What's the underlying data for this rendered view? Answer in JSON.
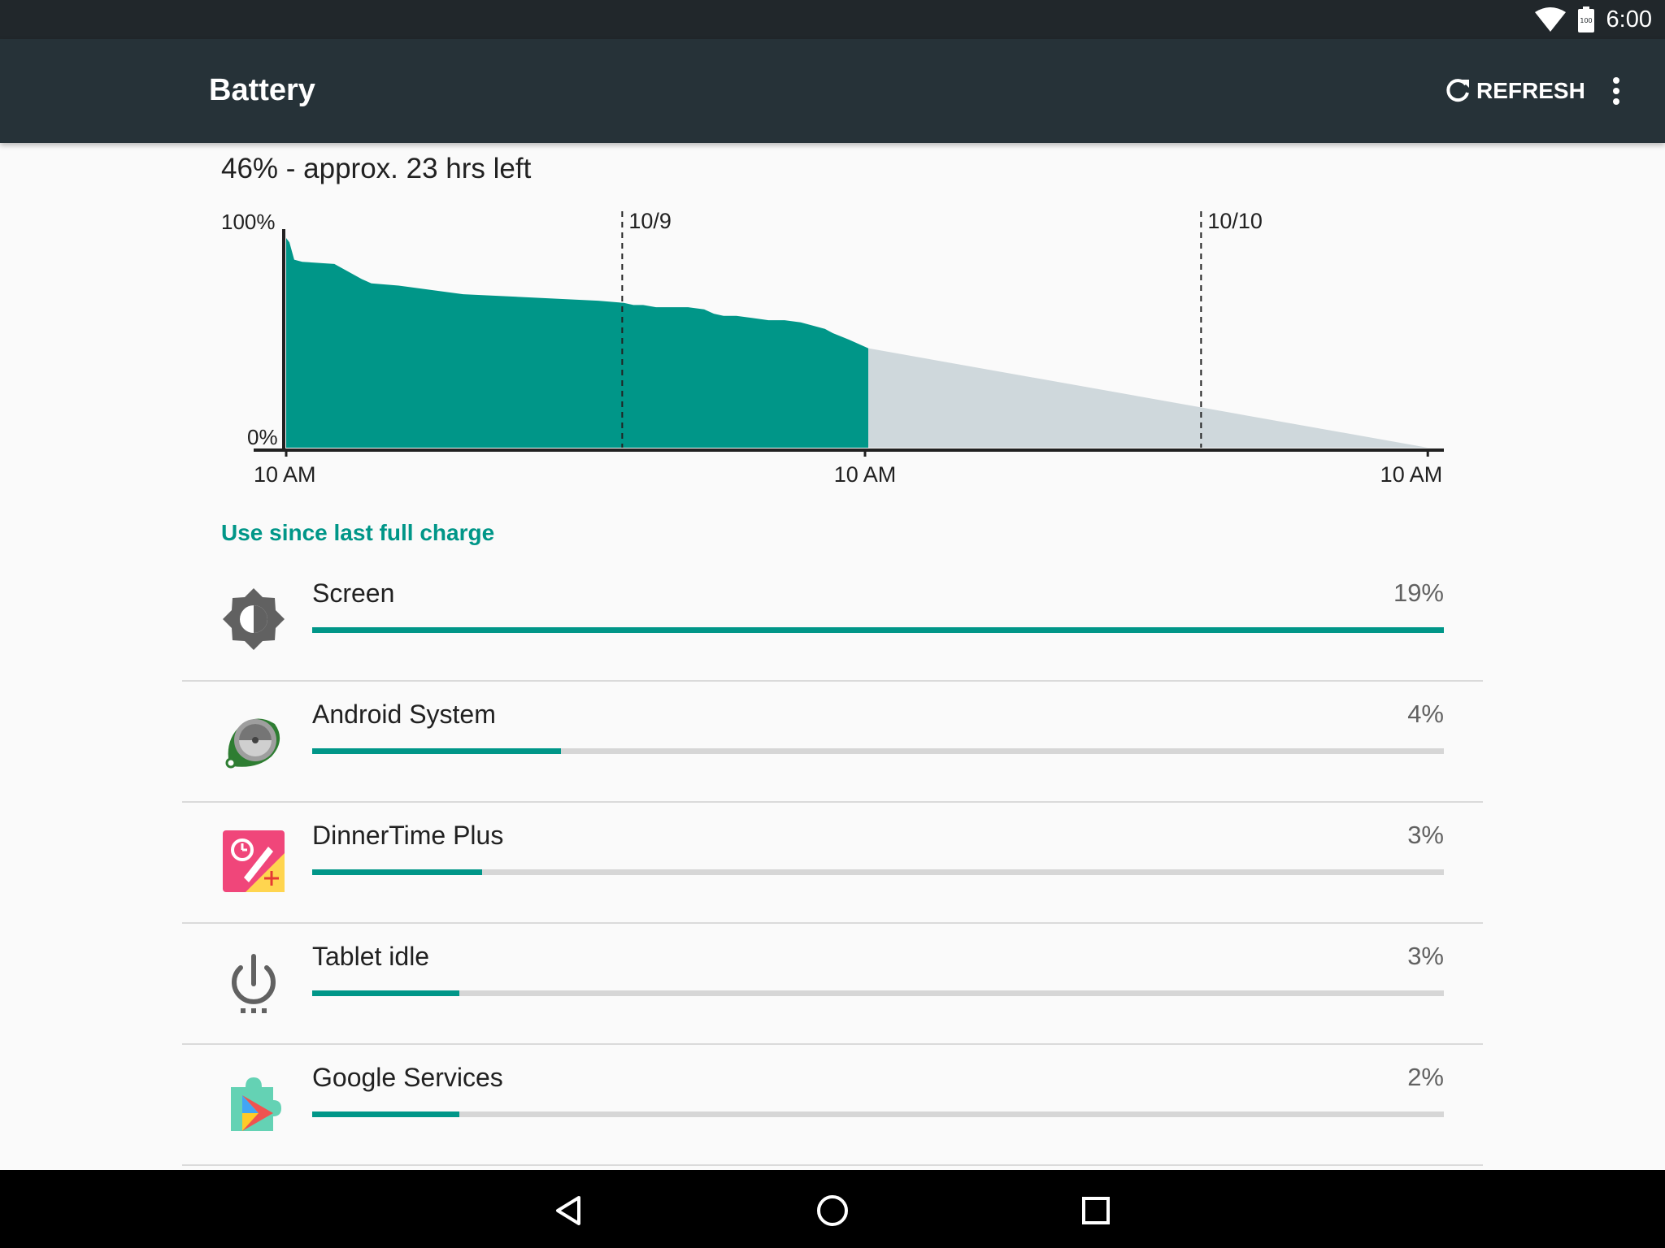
{
  "status_bar": {
    "time": "6:00",
    "battery_icon_text": "100",
    "icons": [
      "wifi-icon",
      "battery-icon"
    ]
  },
  "app_bar": {
    "title": "Battery",
    "refresh_label": "REFRESH",
    "icons": [
      "refresh-icon",
      "overflow-menu-icon"
    ]
  },
  "summary": {
    "text": "46% - approx. 23 hrs left"
  },
  "chart_data": {
    "type": "area",
    "y_labels": [
      "100%",
      "0%"
    ],
    "ylim": [
      0,
      100
    ],
    "x_tick_labels": [
      "10 AM",
      "10 AM",
      "10 AM"
    ],
    "day_markers": [
      "10/9",
      "10/10"
    ],
    "series": [
      {
        "kind": "recorded",
        "color": "#009688",
        "x_hours": [
          0,
          0.2,
          0.5,
          1,
          3,
          4.7,
          5.3,
          7,
          11,
          19.4,
          21,
          21.6,
          22.2,
          23,
          25,
          26,
          26.6,
          27.2,
          28,
          29,
          30,
          31,
          32,
          33.5,
          34,
          35,
          36.2
        ],
        "values": [
          97,
          95,
          87,
          86,
          85,
          78,
          76,
          75,
          71,
          68,
          67,
          66,
          66,
          65,
          65,
          64,
          62,
          61,
          61,
          60,
          59,
          59,
          58,
          55,
          53,
          50,
          46
        ]
      },
      {
        "kind": "projected",
        "color": "#cfd8dc",
        "x_hours": [
          36.2,
          71
        ],
        "values": [
          46,
          0
        ]
      }
    ],
    "x_range_hours": [
      0,
      72
    ],
    "day_marker_hours": [
      20.9,
      56.9
    ],
    "tick_hours": [
      0,
      36,
      71
    ],
    "grid": false
  },
  "usage": {
    "header": "Use since last full charge",
    "items": [
      {
        "label": "Screen",
        "percent": "19%",
        "fraction": 1.0,
        "icon": "brightness-icon"
      },
      {
        "label": "Android System",
        "percent": "4%",
        "fraction": 0.22,
        "icon": "android-system-icon"
      },
      {
        "label": "DinnerTime Plus",
        "percent": "3%",
        "fraction": 0.15,
        "icon": "dinnertime-plus-icon"
      },
      {
        "label": "Tablet idle",
        "percent": "3%",
        "fraction": 0.13,
        "icon": "power-idle-icon"
      },
      {
        "label": "Google Services",
        "percent": "2%",
        "fraction": 0.13,
        "icon": "google-services-icon"
      }
    ]
  },
  "nav_bar": {
    "icons": [
      "back-icon",
      "home-icon",
      "recents-icon"
    ]
  }
}
